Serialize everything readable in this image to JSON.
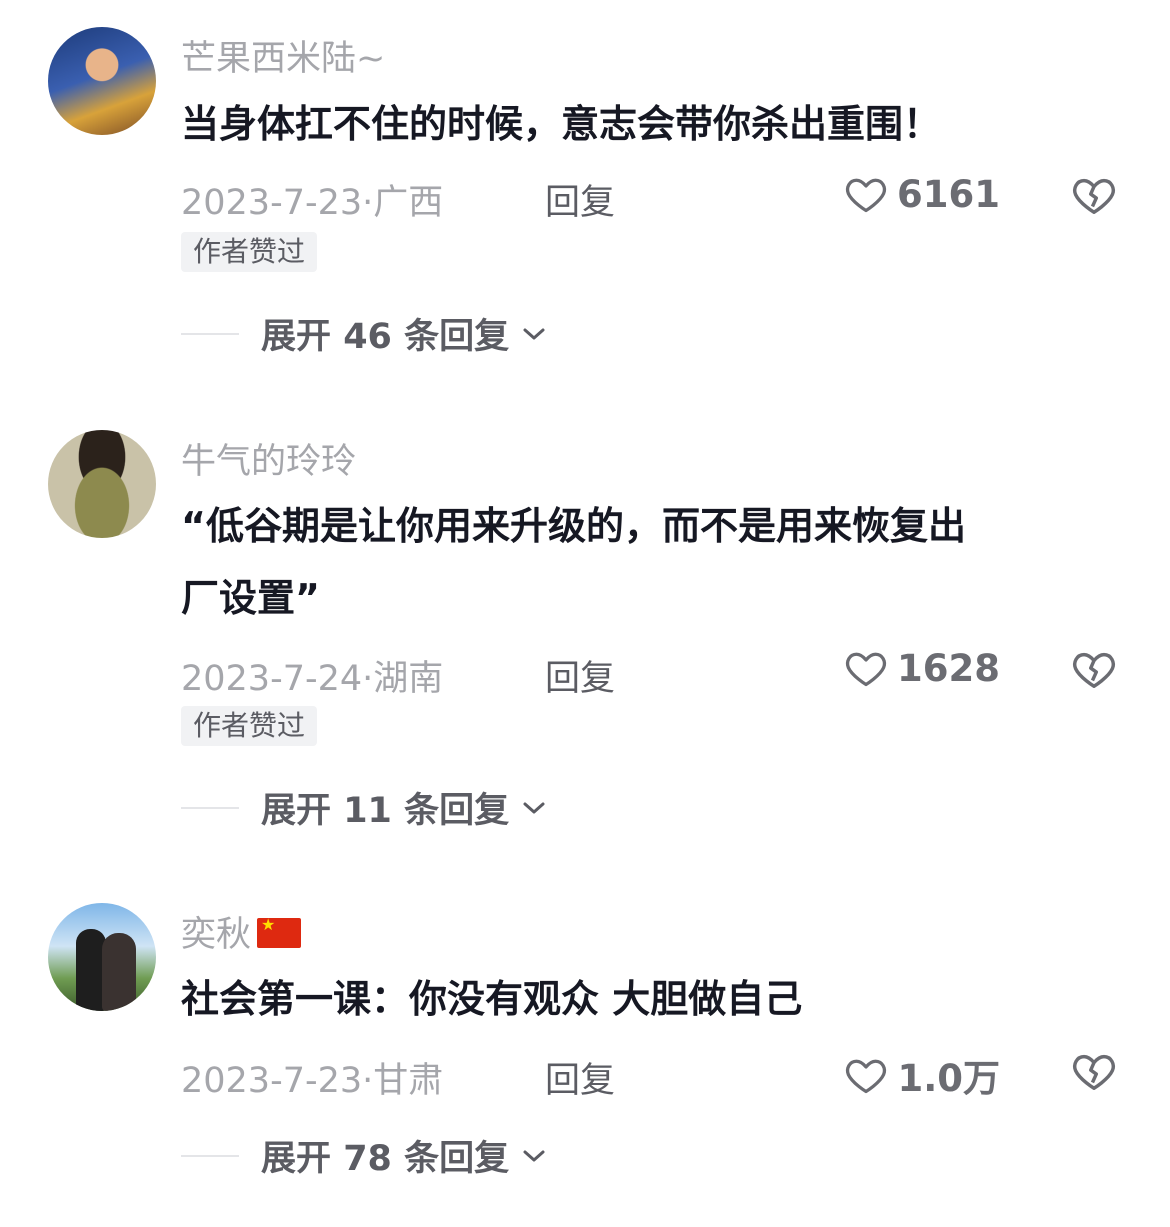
{
  "comments": [
    {
      "username": "芒果西米陆~",
      "text": "当身体扛不住的时候，意志会带你杀出重围！",
      "date": "2023-7-23·",
      "location": "广西",
      "reply_label": "回复",
      "likes": "6161",
      "badge": "作者赞过",
      "expand_prefix": "展开",
      "expand_count": "46",
      "expand_suffix": "条回复"
    },
    {
      "username": "牛气的玲玲",
      "text_line1": "“低谷期是让你用来升级的，而不是用来恢复出",
      "text_line2": "厂设置”",
      "date": "2023-7-24·",
      "location": "湖南",
      "reply_label": "回复",
      "likes": "1628",
      "badge": "作者赞过",
      "expand_prefix": "展开",
      "expand_count": "11",
      "expand_suffix": "条回复"
    },
    {
      "username": "奕秋",
      "text": "社会第一课：你没有观众 大胆做自己",
      "date": "2023-7-23·",
      "location": "甘肃",
      "reply_label": "回复",
      "likes": "1.0万",
      "expand_prefix": "展开",
      "expand_count": "78",
      "expand_suffix": "条回复"
    }
  ],
  "icons": {
    "like": "heart-outline-icon",
    "dislike": "broken-heart-icon",
    "expand": "chevron-down-icon",
    "flag": "china-flag-icon"
  },
  "colors": {
    "username": "#a5a6ab",
    "text": "#161823",
    "secondary": "#5b5c63",
    "badge_bg": "#f1f2f4",
    "flag_red": "#de2910"
  }
}
